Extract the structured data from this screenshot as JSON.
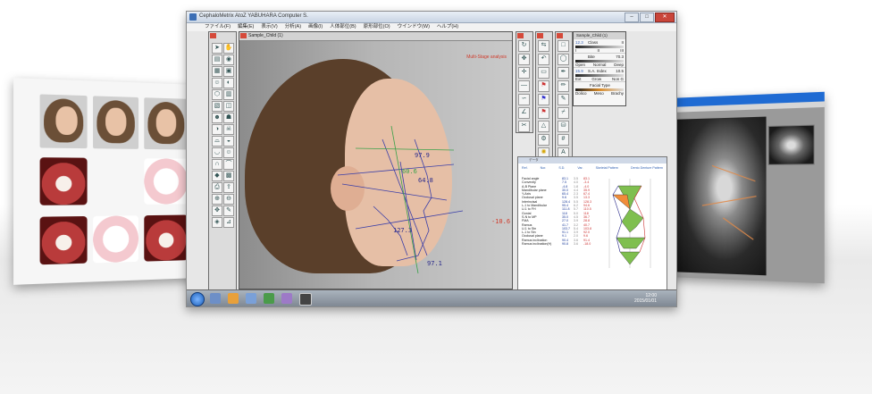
{
  "main_window": {
    "title": "CephaloMetrix AtoZ  YABUHARA Computer S.",
    "menu": [
      "ファイル(F)",
      "編集(E)",
      "表示(V)",
      "分析(A)",
      "画像(I)",
      "人体部位(B)",
      "原形部位(O)",
      "ウインドウ(W)",
      "ヘルプ(H)"
    ],
    "buttons": {
      "minimize": "–",
      "maximize": "□",
      "close": "✕"
    }
  },
  "doc_window": {
    "title": "Sample_Child (1)",
    "analysis_label": "Multi-Stage analysis",
    "measurements": [
      {
        "text": "97.9",
        "color": "blue"
      },
      {
        "text": "60.6",
        "color": "green"
      },
      {
        "text": "64.8",
        "color": "blue"
      },
      {
        "text": "127.3",
        "color": "blue"
      },
      {
        "text": "97.1",
        "color": "blue"
      },
      {
        "text": "-10.6",
        "color": "red"
      }
    ]
  },
  "class_panel": {
    "title": "Sample_Child (1)",
    "rows": [
      {
        "num": "12.3",
        "label": "Class",
        "value": "II",
        "options": [
          "I",
          "II",
          "III"
        ]
      },
      {
        "num": "",
        "label": "Bite",
        "value": "70.3",
        "options": [
          "Open",
          "Normal",
          "Deep"
        ]
      },
      {
        "num": "15.9",
        "label": "S.A. Index",
        "value": "10.5",
        "options": [
          "Ext",
          "Grow",
          "Non G"
        ]
      },
      {
        "num": "",
        "label": "Facial Type",
        "value": "",
        "options": [
          "Dolico",
          "Meso",
          "Brachy"
        ]
      }
    ]
  },
  "data_panel": {
    "title": "データ",
    "header": {
      "col1": "Nor.",
      "col2": "S.D.",
      "col3": "Var.",
      "col4": "S.D.",
      "left": "Ref.",
      "mid": "Skeletal Pattern",
      "right": "Dento Denture Pattern"
    },
    "rows": [
      {
        "name": "Facial angle",
        "v": "83.1",
        "v2": "3.5",
        "v3": "83.1"
      },
      {
        "name": "Convexity",
        "v": "7.5",
        "v2": "4.0",
        "v3": "-3.4"
      },
      {
        "name": "A-B Plane",
        "v": "-4.8",
        "v2": "1.8",
        "v3": "-4.0"
      },
      {
        "name": "Mandibular plane",
        "v": "30.0",
        "v2": "4.4",
        "v3": "35.9"
      },
      {
        "name": "Y-Axis",
        "v": "65.4",
        "v2": "2.3",
        "v3": "67.4"
      },
      {
        "name": "Occlusal plane",
        "v": "9.6",
        "v2": "3.5",
        "v3": "13.3"
      },
      {
        "name": "Interincisal",
        "v": "128.4",
        "v2": "5.5",
        "v3": "128.3"
      },
      {
        "name": "L-1 to Mandibular",
        "v": "95.4",
        "v2": "6.2",
        "v3": "94.6"
      },
      {
        "name": "U-1 to FH",
        "v": "111.8",
        "v2": "5.7",
        "v3": "110.5"
      },
      {
        "name": "Gonial",
        "v": "118",
        "v2": "5.0",
        "v3": "118"
      },
      {
        "name": "S-N to MP",
        "v": "35.0",
        "v2": "4.5",
        "v3": "36.7"
      },
      {
        "name": "FMA",
        "v": "27.0",
        "v2": "3.9",
        "v3": "28.8"
      },
      {
        "name": "Ramus",
        "v": "41.7",
        "v2": "3.2",
        "v3": "40.7"
      },
      {
        "name": "U-1 to Stn",
        "v": "103.7",
        "v2": "5.4",
        "v3": "103.8"
      },
      {
        "name": "L-1 to Stn",
        "v": "91.1",
        "v2": "3.9",
        "v3": "92.0"
      },
      {
        "name": "Occlusal plane",
        "v": "9.1",
        "v2": "2.0",
        "v3": "9.6"
      },
      {
        "name": "Ramus inclination",
        "v": "90.4",
        "v2": "3.6",
        "v3": "91.4"
      },
      {
        "name": "Ramus inclination(H)",
        "v": "90.8",
        "v2": "3.6",
        "v3": "-18.0"
      }
    ]
  },
  "taskbar": {
    "time": "12:00",
    "date": "2015/01/01"
  },
  "colors": {
    "accent": "#1f6bd3",
    "close": "#c9453a",
    "measure_blue": "#2a2a8a",
    "measure_green": "#3aa24a",
    "measure_red": "#d03c2c"
  }
}
